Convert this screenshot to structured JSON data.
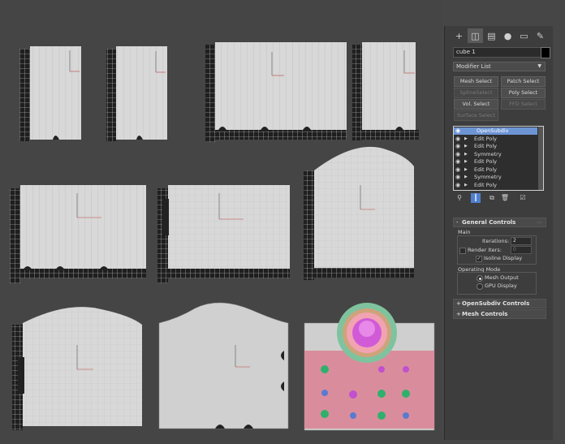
{
  "command_panel": {
    "tabs": [
      {
        "name": "create",
        "glyph": "+"
      },
      {
        "name": "modify",
        "glyph": "◫"
      },
      {
        "name": "hierarchy",
        "glyph": "▤"
      },
      {
        "name": "motion",
        "glyph": "●"
      },
      {
        "name": "display",
        "glyph": "▭"
      },
      {
        "name": "utilities",
        "glyph": "✎"
      }
    ],
    "object_name": "cube 1",
    "object_color": "#000000",
    "modifier_list_label": "Modifier List",
    "quick_buttons": [
      {
        "label": "Mesh Select",
        "enabled": true
      },
      {
        "label": "Patch Select",
        "enabled": true
      },
      {
        "label": "SplineSelect",
        "enabled": false
      },
      {
        "label": "Poly Select",
        "enabled": true
      },
      {
        "label": "Vol. Select",
        "enabled": true
      },
      {
        "label": "FFD Select",
        "enabled": false
      },
      {
        "label": "Surface Select",
        "enabled": false
      }
    ],
    "stack": [
      {
        "label": "OpenSubdiv",
        "selected": true
      },
      {
        "label": "Edit Poly",
        "selected": false
      },
      {
        "label": "Edit Poly",
        "selected": false
      },
      {
        "label": "Symmetry",
        "selected": false
      },
      {
        "label": "Edit Poly",
        "selected": false
      },
      {
        "label": "Edit Poly",
        "selected": false
      },
      {
        "label": "Symmetry",
        "selected": false
      },
      {
        "label": "Edit Poly",
        "selected": false
      }
    ],
    "general_controls": {
      "title": "General Controls",
      "expand_sign": "-",
      "main_label": "Main",
      "iterations_label": "Iterations:",
      "iterations_value": "2",
      "render_iters_label": "Render Iters:",
      "render_iters_value": "0",
      "render_iters_checked": false,
      "isoline_label": "Isoline Display",
      "isoline_checked": true,
      "operating_mode_label": "Operating Mode",
      "mesh_output_label": "Mesh Output",
      "gpu_display_label": "GPU Display",
      "mode_selected": "Mesh Output"
    },
    "rollouts_collapsed": [
      {
        "title": "OpenSubdiv Controls",
        "expand_sign": "+"
      },
      {
        "title": "Mesh Controls",
        "expand_sign": "+"
      }
    ]
  }
}
